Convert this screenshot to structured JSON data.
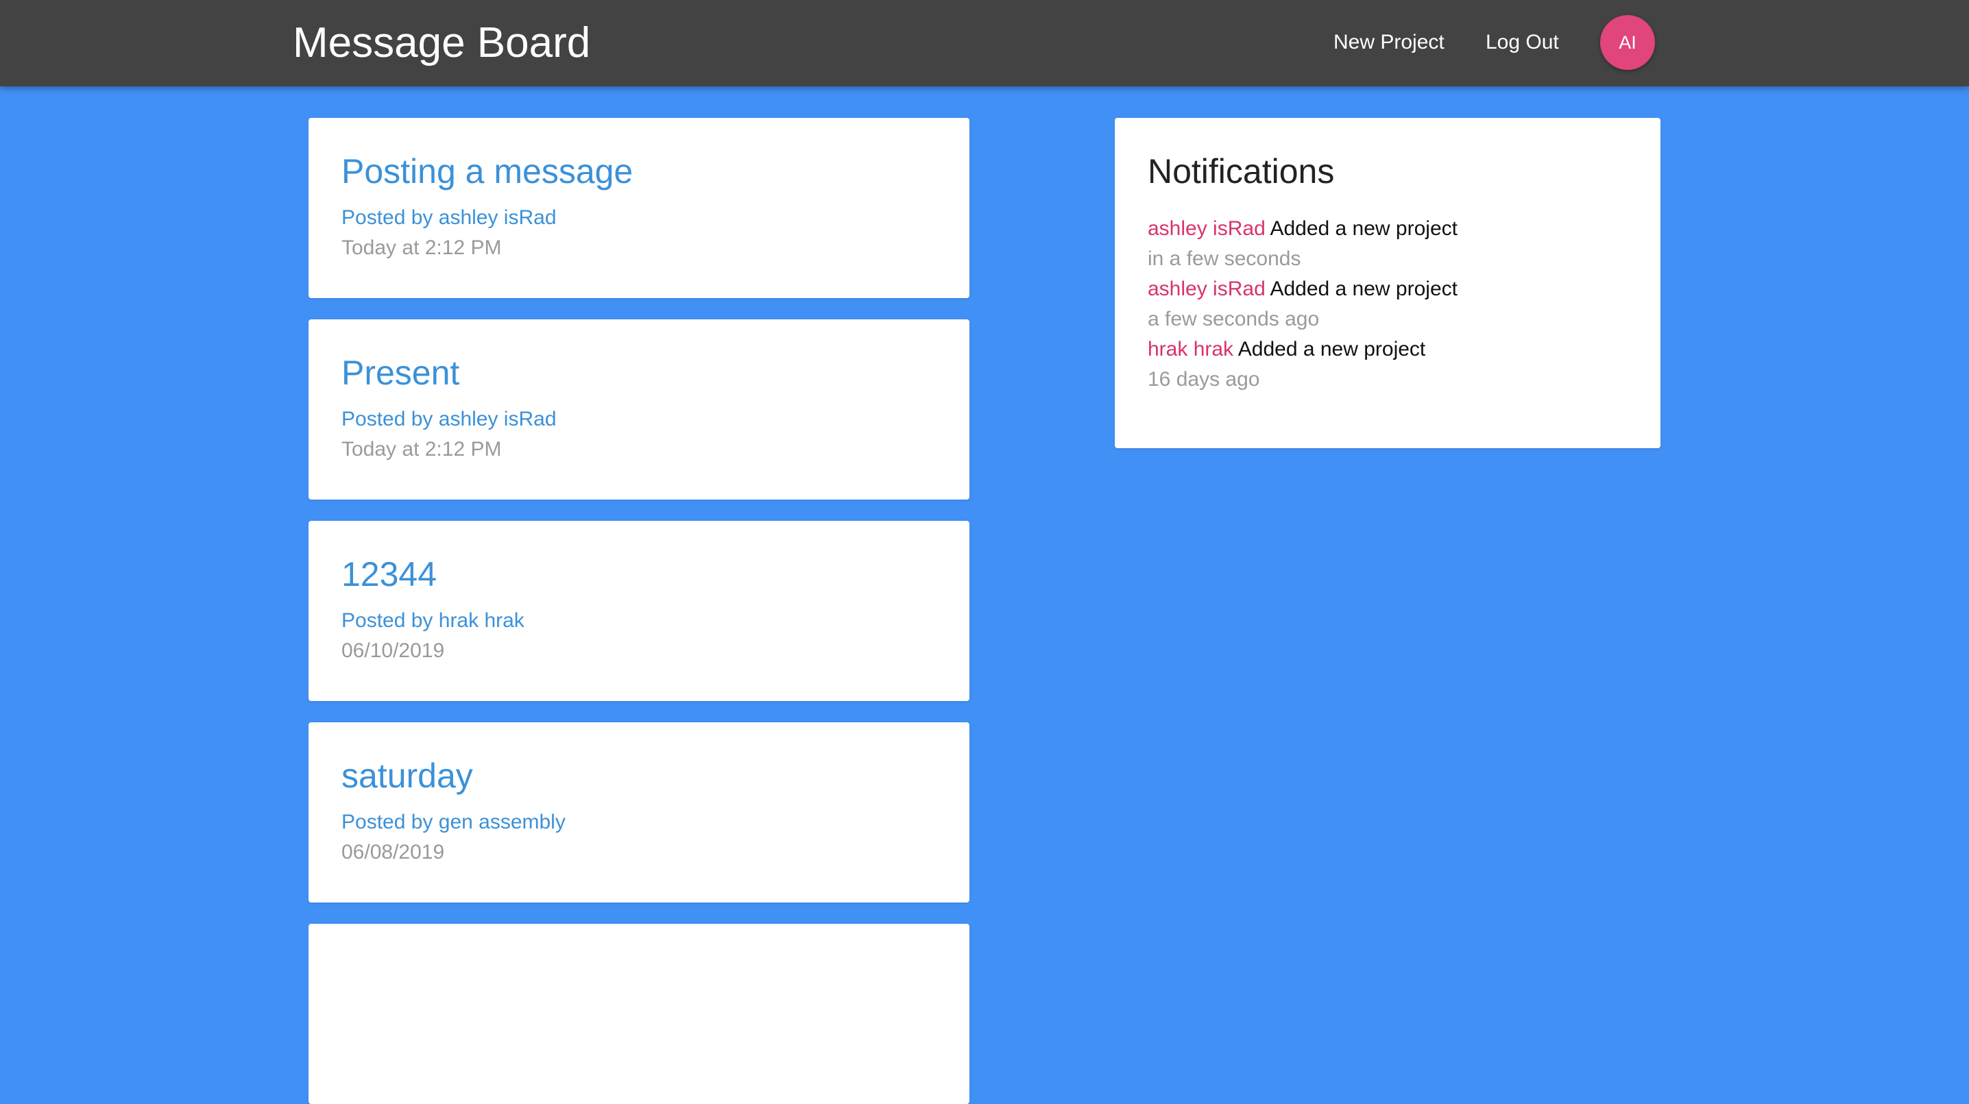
{
  "navbar": {
    "brand": "Message Board",
    "links": [
      {
        "label": "New Project"
      },
      {
        "label": "Log Out"
      }
    ],
    "avatar_initials": "AI"
  },
  "projects": [
    {
      "title": "Posting a message",
      "author": "Posted by ashley isRad",
      "date": "Today at 2:12 PM"
    },
    {
      "title": "Present",
      "author": "Posted by ashley isRad",
      "date": "Today at 2:12 PM"
    },
    {
      "title": "12344",
      "author": "Posted by hrak hrak",
      "date": "06/10/2019"
    },
    {
      "title": "saturday",
      "author": "Posted by gen assembly",
      "date": "06/08/2019"
    }
  ],
  "notifications": {
    "title": "Notifications",
    "items": [
      {
        "user": "ashley isRad",
        "content": "Added a new project",
        "time": "in a few seconds"
      },
      {
        "user": "ashley isRad",
        "content": "Added a new project",
        "time": "a few seconds ago"
      },
      {
        "user": "hrak hrak",
        "content": "Added a new project",
        "time": "16 days ago"
      }
    ]
  },
  "colors": {
    "background": "#4190f6",
    "navbar": "#434343",
    "avatar": "#e0457b",
    "link_blue": "#3b91d8",
    "notification_user": "#d8336a"
  }
}
